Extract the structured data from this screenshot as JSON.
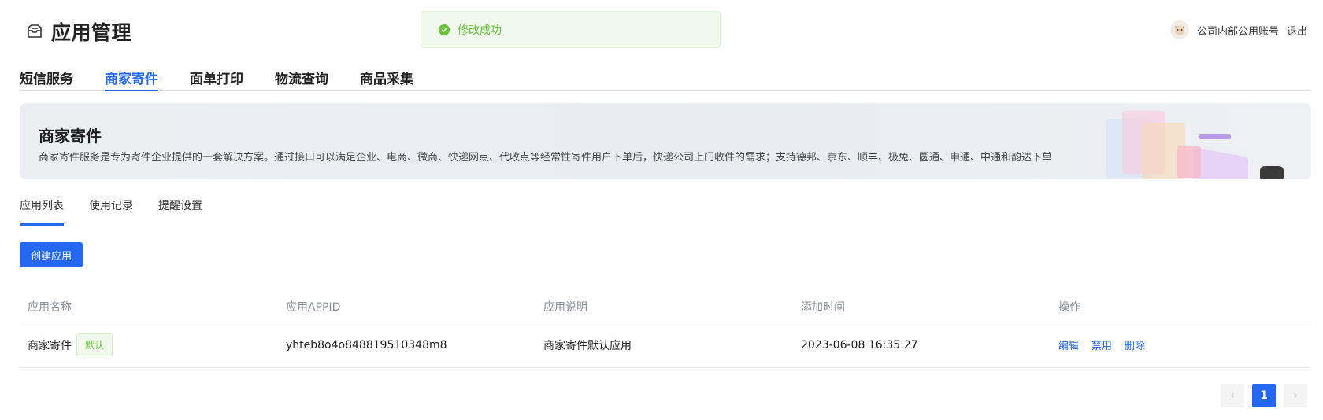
{
  "header": {
    "title": "应用管理",
    "user_name": "公司内部公用账号",
    "logout_label": "退出"
  },
  "toast": {
    "message": "修改成功"
  },
  "top_tabs": [
    {
      "label": "短信服务"
    },
    {
      "label": "商家寄件"
    },
    {
      "label": "面单打印"
    },
    {
      "label": "物流查询"
    },
    {
      "label": "商品采集"
    }
  ],
  "banner": {
    "title": "商家寄件",
    "description": "商家寄件服务是专为寄件企业提供的一套解决方案。通过接口可以满足企业、电商、微商、快递网点、代收点等经常性寄件用户下单后，快递公司上门收件的需求；支持德邦、京东、顺丰、极兔、圆通、申通、中通和韵达下单"
  },
  "sub_tabs": [
    {
      "label": "应用列表"
    },
    {
      "label": "使用记录"
    },
    {
      "label": "提醒设置"
    }
  ],
  "create_button": "创建应用",
  "table": {
    "headers": [
      "应用名称",
      "应用APPID",
      "应用说明",
      "添加时间",
      "操作"
    ],
    "rows": [
      {
        "name": "商家寄件",
        "badge": "默认",
        "appid": "yhteb8o4o848819510348m8",
        "desc": "商家寄件默认应用",
        "time": "2023-06-08 16:35:27",
        "ops": [
          "编辑",
          "禁用",
          "删除"
        ]
      }
    ]
  },
  "pagination": {
    "prev": "‹",
    "current": "1",
    "next": "›"
  },
  "colors": {
    "accent": "#2468f2",
    "success": "#67c23a"
  }
}
